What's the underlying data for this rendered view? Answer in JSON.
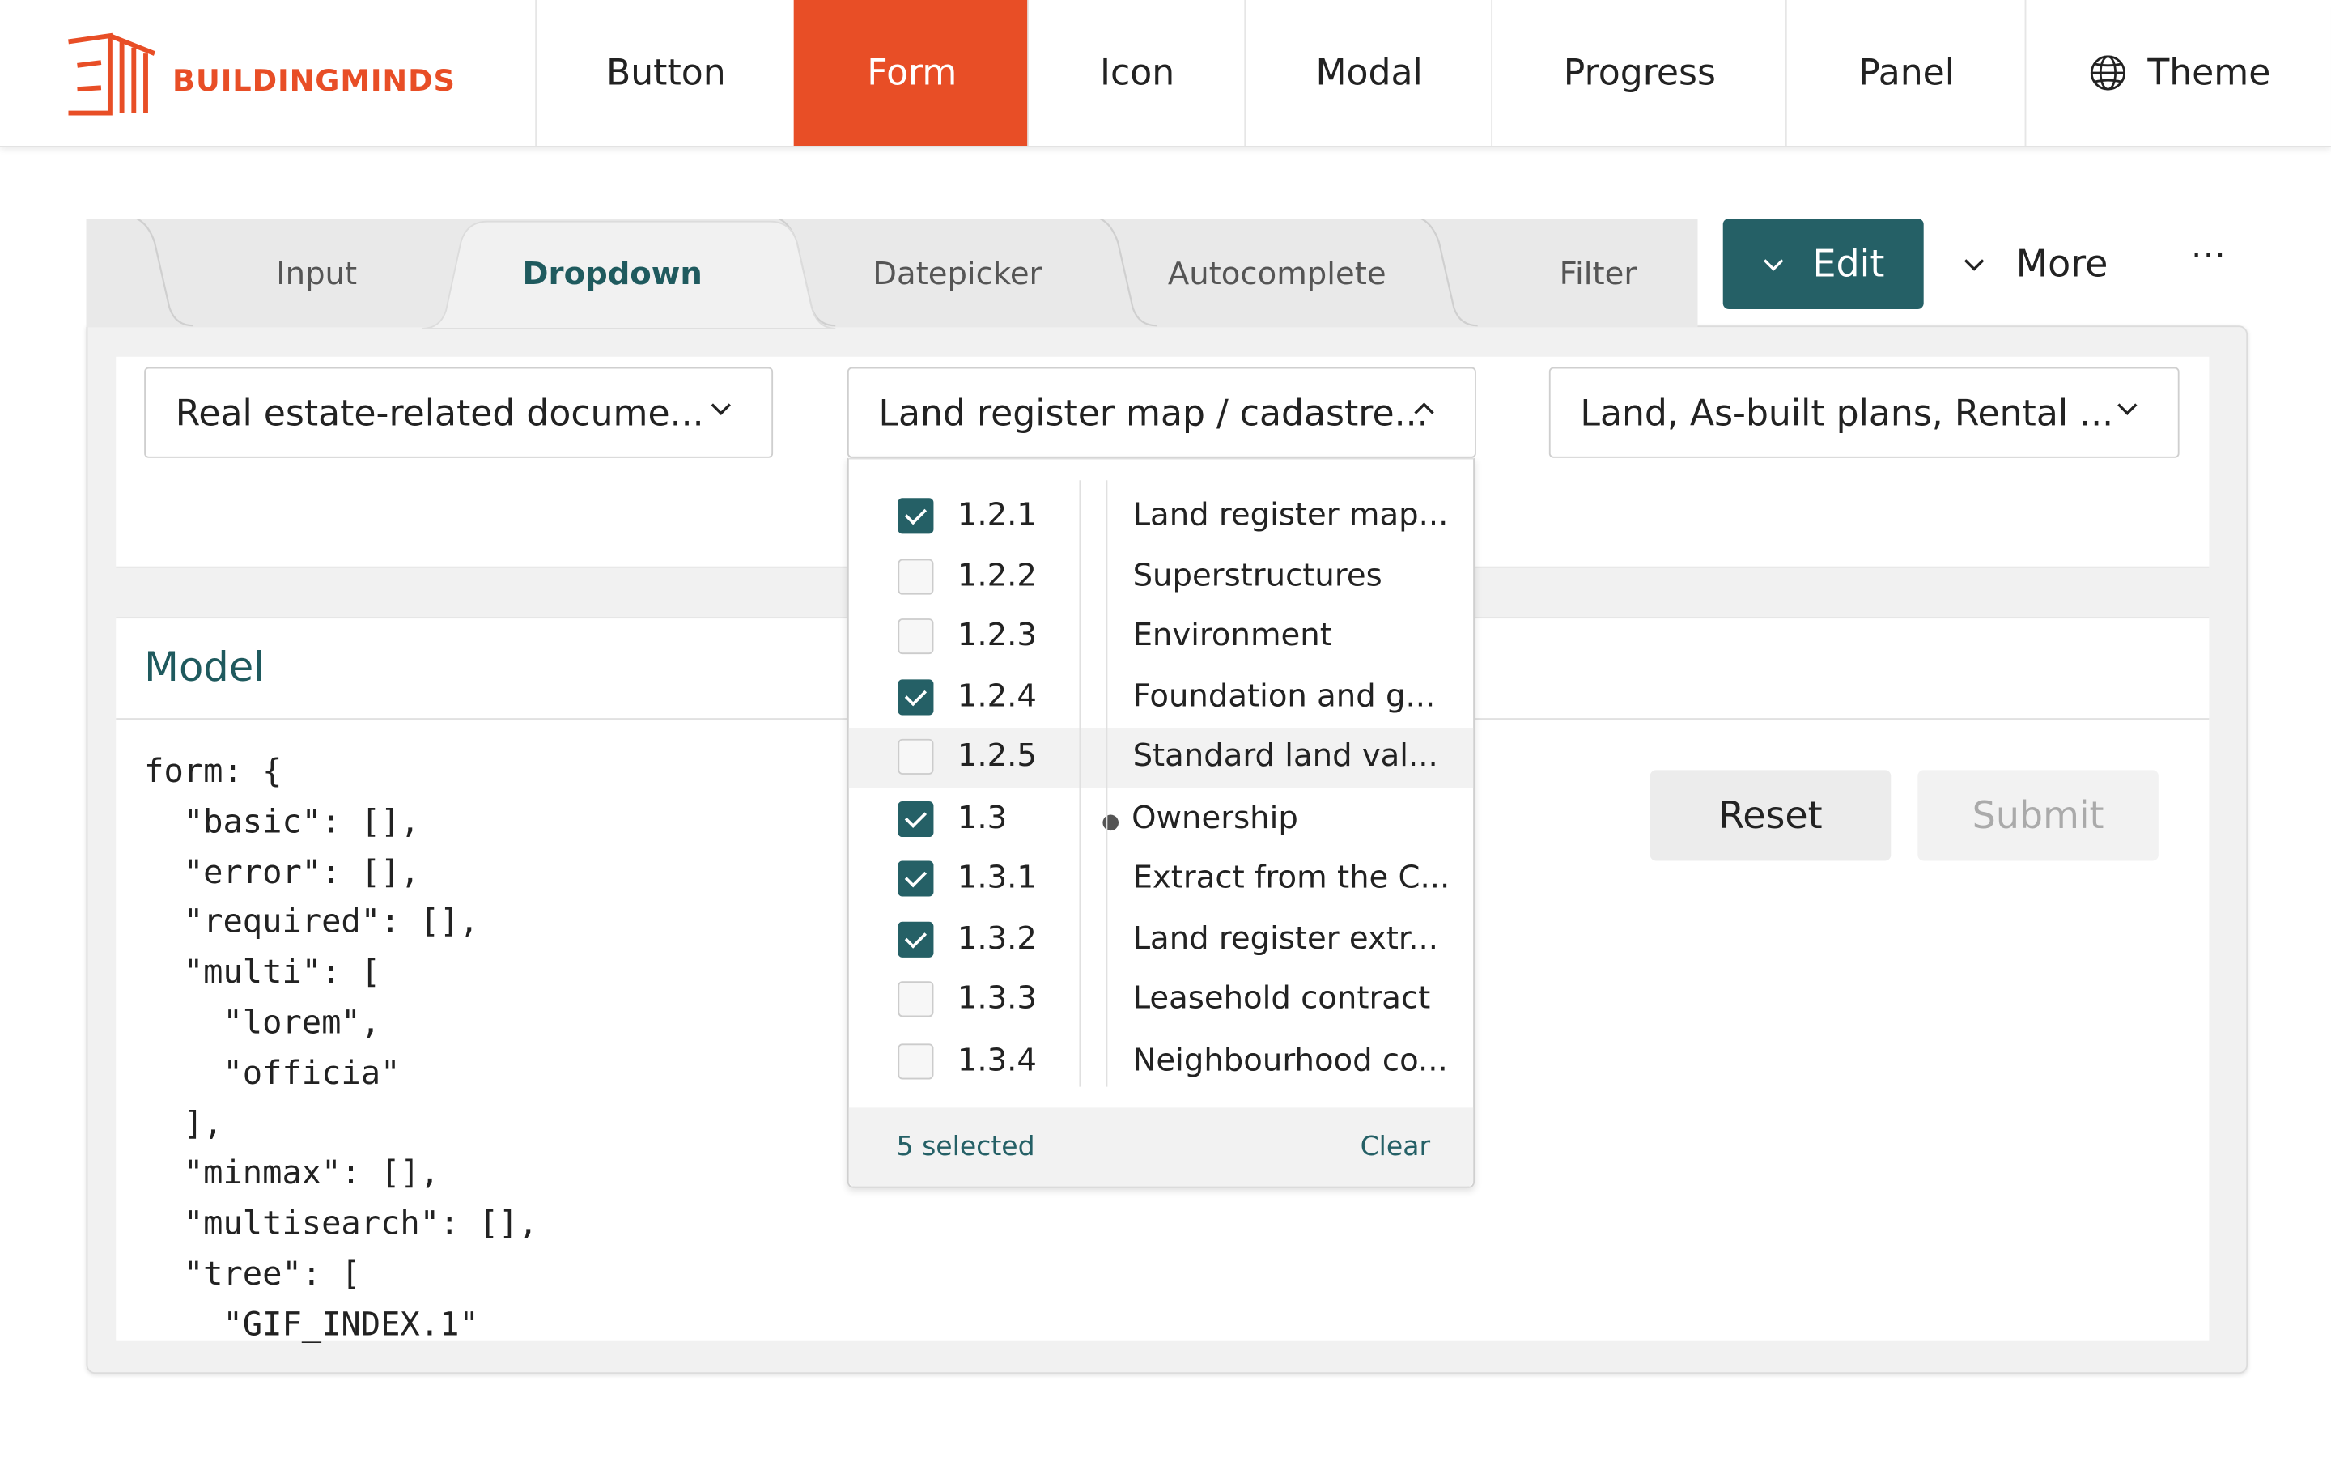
{
  "brand": {
    "name": "BUILDINGMINDS",
    "color": "#e84e26"
  },
  "nav": {
    "items": [
      {
        "label": "Button"
      },
      {
        "label": "Form"
      },
      {
        "label": "Icon"
      },
      {
        "label": "Modal"
      },
      {
        "label": "Progress"
      },
      {
        "label": "Panel"
      },
      {
        "label": "Theme"
      }
    ],
    "active": "Form"
  },
  "tabs": {
    "items": [
      "Input",
      "Dropdown",
      "Datepicker",
      "Autocomplete",
      "Filter"
    ],
    "active": "Dropdown"
  },
  "actions": {
    "edit": "Edit",
    "more": "More",
    "overflow": "···"
  },
  "dropdowns": {
    "first": "Real estate-related docume...",
    "second": "Land register map / cadastre...",
    "third": "Land, As-built plans, Rental ..."
  },
  "menu": {
    "options": [
      {
        "code": "1.2.1",
        "label": "Land register map...",
        "checked": true
      },
      {
        "code": "1.2.2",
        "label": "Superstructures",
        "checked": false
      },
      {
        "code": "1.2.3",
        "label": "Environment",
        "checked": false
      },
      {
        "code": "1.2.4",
        "label": "Foundation and g...",
        "checked": true
      },
      {
        "code": "1.2.5",
        "label": "Standard land val...",
        "checked": false
      },
      {
        "code": "1.3",
        "label": "Ownership",
        "checked": true
      },
      {
        "code": "1.3.1",
        "label": "Extract from the C...",
        "checked": true
      },
      {
        "code": "1.3.2",
        "label": "Land register extr...",
        "checked": true
      },
      {
        "code": "1.3.3",
        "label": "Leasehold contract",
        "checked": false
      },
      {
        "code": "1.3.4",
        "label": "Neighbourhood co...",
        "checked": false
      }
    ],
    "selected_count": "5 selected",
    "clear": "Clear"
  },
  "model": {
    "title": "Model",
    "code": "form: {\n  \"basic\": [],\n  \"error\": [],\n  \"required\": [],\n  \"multi\": [\n    \"lorem\",\n    \"officia\"\n  ],\n  \"minmax\": [],\n  \"multisearch\": [],\n  \"tree\": [\n    \"GIF_INDEX.1\""
  },
  "buttons": {
    "reset": "Reset",
    "submit": "Submit"
  },
  "colors": {
    "accent": "#256066",
    "brand": "#e84e26"
  }
}
